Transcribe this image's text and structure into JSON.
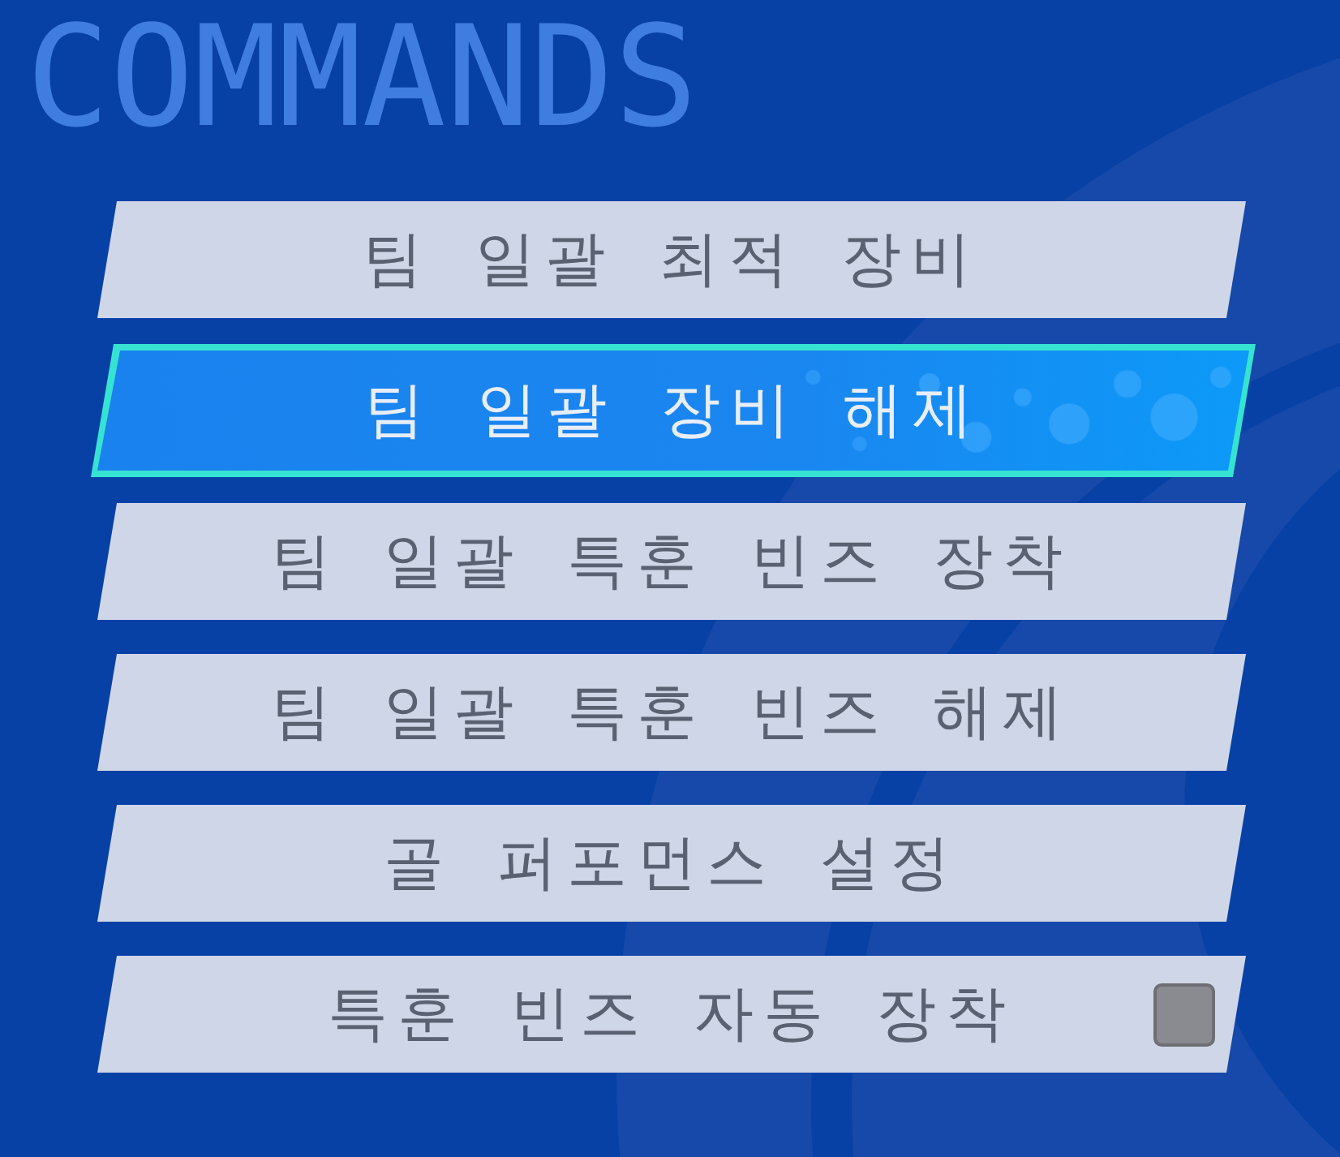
{
  "title": "COMMANDS",
  "commands": [
    {
      "label": "팀 일괄 최적 장비",
      "kind": "action",
      "selected": false
    },
    {
      "label": "팀 일괄 장비 해제",
      "kind": "action",
      "selected": true
    },
    {
      "label": "팀 일괄 특훈 빈즈 장착",
      "kind": "action",
      "selected": false
    },
    {
      "label": "팀 일괄 특훈 빈즈 해제",
      "kind": "action",
      "selected": false
    },
    {
      "label": "골 퍼포먼스 설정",
      "kind": "action",
      "selected": false
    },
    {
      "label": "특훈 빈즈 자동 장착",
      "kind": "toggle",
      "selected": false,
      "checked": false
    }
  ]
}
